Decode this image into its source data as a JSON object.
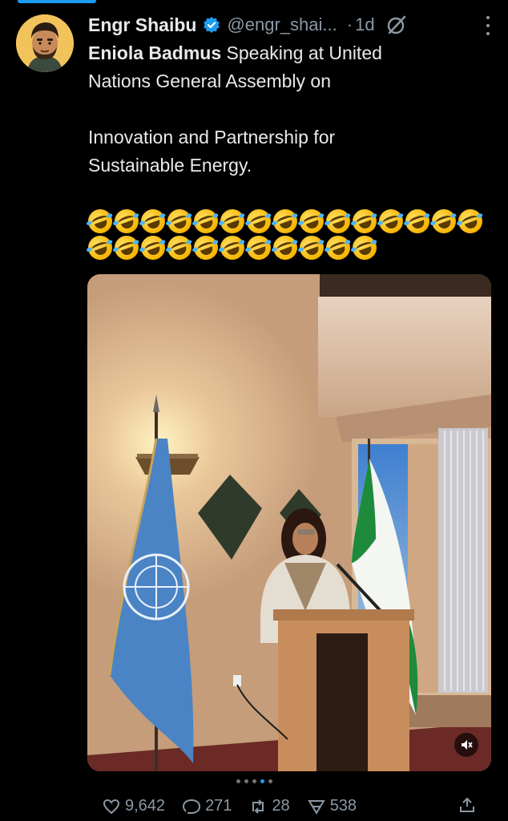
{
  "tweet": {
    "author_name": "Engr Shaibu",
    "handle": "@engr_shai...",
    "separator": "·",
    "time": "1d",
    "verified": true,
    "text_line1_mention": "Eniola Badmus",
    "text_line1_rest": " Speaking at United",
    "text_line2": "Nations General Assembly on",
    "text_line3": "Innovation and Partnership for",
    "text_line4": "Sustainable Energy.",
    "emoji_row1_count": 15,
    "emoji_row2_count": 11,
    "emoji_name": "rolling-on-the-floor-laughing-emoji"
  },
  "media": {
    "type": "video",
    "muted": true,
    "pager_total": 5,
    "pager_active_index": 3
  },
  "actions": {
    "likes": "9,642",
    "replies": "271",
    "reposts": "28",
    "views": "538"
  },
  "colors": {
    "accent": "#1d9bf0",
    "background": "#000000",
    "text": "#e7e9ea",
    "muted": "#8b98a5"
  }
}
